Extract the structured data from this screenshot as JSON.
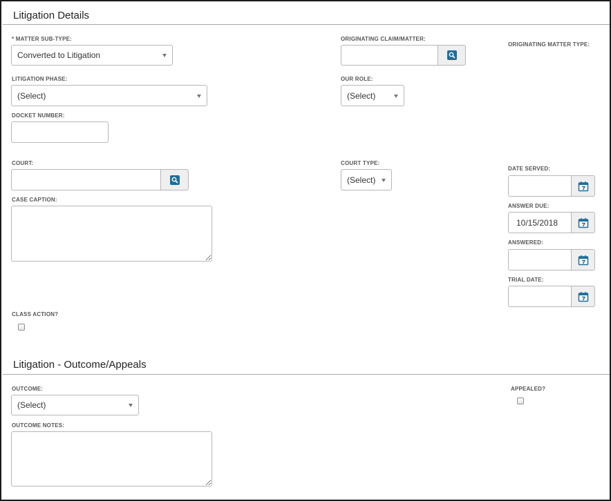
{
  "litigation_details": {
    "title": "Litigation Details",
    "matter_subtype": {
      "label": "* MATTER SUB-TYPE:",
      "value": "Converted to Litigation"
    },
    "originating_claim": {
      "label": "ORIGINATING CLAIM/MATTER:",
      "value": ""
    },
    "originating_matter_type": {
      "label": "ORIGINATING MATTER TYPE:"
    },
    "litigation_phase": {
      "label": "LITIGATION PHASE:",
      "value": "(Select)"
    },
    "our_role": {
      "label": "OUR ROLE:",
      "value": "(Select)"
    },
    "docket_number": {
      "label": "DOCKET NUMBER:",
      "value": ""
    },
    "court": {
      "label": "COURT:",
      "value": ""
    },
    "court_type": {
      "label": "COURT TYPE:",
      "value": "(Select)"
    },
    "date_served": {
      "label": "DATE SERVED:",
      "value": ""
    },
    "case_caption": {
      "label": "CASE CAPTION:",
      "value": ""
    },
    "answer_due": {
      "label": "ANSWER DUE:",
      "value": "10/15/2018"
    },
    "answered": {
      "label": "ANSWERED:",
      "value": ""
    },
    "trial_date": {
      "label": "TRIAL DATE:",
      "value": ""
    },
    "class_action": {
      "label": "CLASS ACTION?",
      "checked": false
    }
  },
  "outcome_appeals": {
    "title": "Litigation - Outcome/Appeals",
    "outcome": {
      "label": "OUTCOME:",
      "value": "(Select)"
    },
    "appealed": {
      "label": "APPEALED?",
      "checked": false
    },
    "outcome_notes": {
      "label": "OUTCOME NOTES:",
      "value": ""
    }
  },
  "icons": {
    "search": "search-icon",
    "calendar": "calendar-icon"
  },
  "colors": {
    "icon_accent": "#1f6e98",
    "border": "#b6b6b6"
  }
}
